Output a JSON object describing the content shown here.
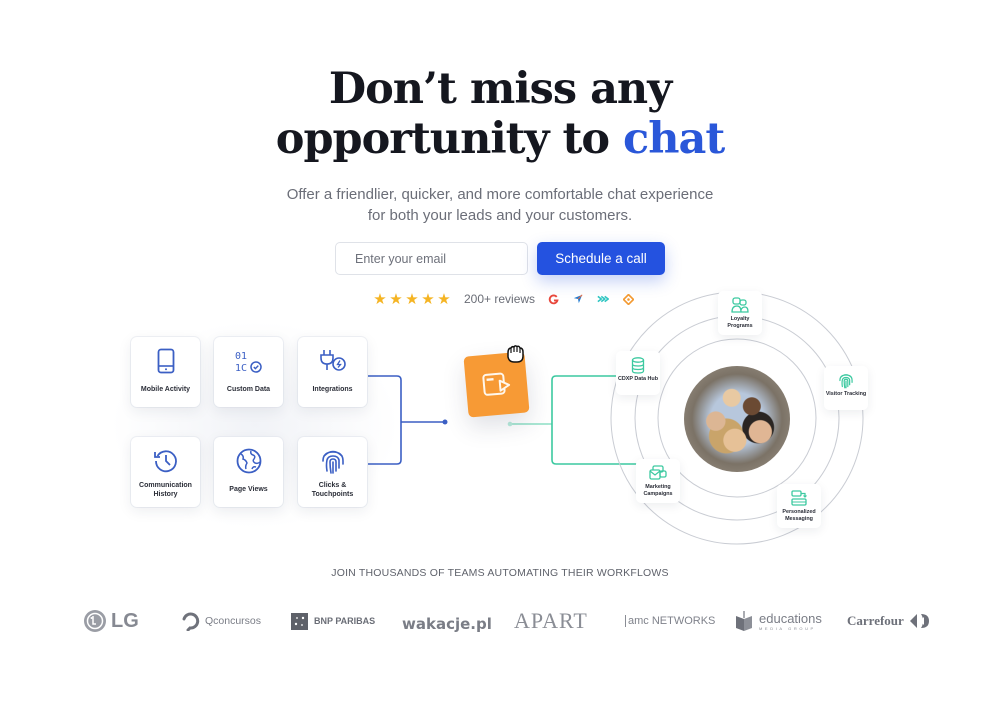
{
  "hero": {
    "headline_line1": "Don’t miss any",
    "headline_line2_prefix": "opportunity to ",
    "headline_accent": "chat",
    "subtitle_line1": "Offer a friendlier, quicker, and more comfortable chat experience",
    "subtitle_line2": "for both your leads and your customers."
  },
  "form": {
    "email_placeholder": "Enter your email",
    "email_value": "",
    "cta_label": "Schedule a call"
  },
  "reviews": {
    "rating_stars": 5,
    "rating_max": 5,
    "count_label": "200+ reviews",
    "platform_icons": [
      "g2-icon",
      "capterra-icon",
      "getapp-icon",
      "software-advice-icon"
    ]
  },
  "data_sources": [
    {
      "label": "Mobile Activity",
      "icon": "mobile-phone-icon"
    },
    {
      "label": "Custom Data",
      "icon": "binary-data-icon"
    },
    {
      "label": "Integrations",
      "icon": "plug-icon"
    },
    {
      "label": "Communication History",
      "icon": "history-icon"
    },
    {
      "label": "Page Views",
      "icon": "globe-icon"
    },
    {
      "label": "Clicks & Touchpoints",
      "icon": "fingerprint-icon"
    }
  ],
  "hub": {
    "icon": "chat-widget-icon",
    "cursor": "grab-hand-icon"
  },
  "outcomes": [
    {
      "label": "Loyalty Programs",
      "icon": "users-icon"
    },
    {
      "label": "CDXP Data Hub",
      "icon": "database-icon"
    },
    {
      "label": "Visitor Tracking",
      "icon": "fingerprint-icon"
    },
    {
      "label": "Marketing Campaigns",
      "icon": "campaign-messages-icon"
    },
    {
      "label": "Personalized Messaging",
      "icon": "message-cards-icon"
    }
  ],
  "social_proof": {
    "tagline": "JOIN THOUSANDS OF TEAMS AUTOMATING THEIR WORKFLOWS",
    "logos": [
      "LG",
      "Qconcursos",
      "BNP PARIBAS",
      "wakacje.pl",
      "APART",
      "amc NETWORKS",
      "educations",
      "Carrefour"
    ],
    "educations_sub": "MEDIA GROUP"
  },
  "colors": {
    "accent_blue": "#2452e0",
    "headline_accent": "#2a57d9",
    "hub_orange": "#f79a35",
    "teal": "#3cc9a0",
    "star": "#f5b423",
    "source_icon": "#3b5fc4"
  }
}
